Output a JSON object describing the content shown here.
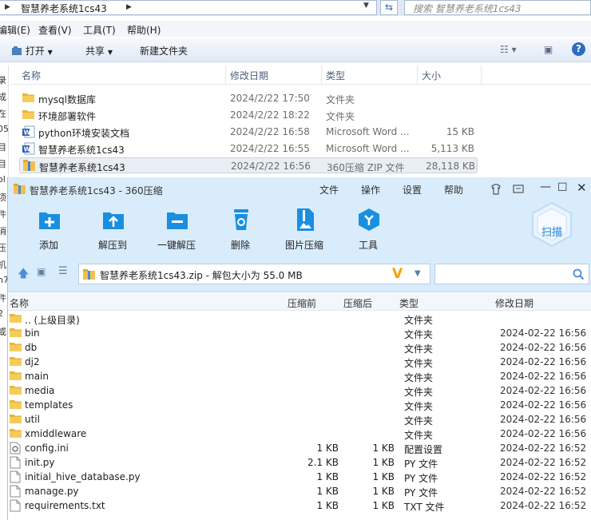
{
  "explorer": {
    "breadcrumb": "智慧养老系统1cs43",
    "search_placeholder": "搜索 智慧养老系统1cs43",
    "menu": [
      "编辑(E)",
      "查看(V)",
      "工具(T)",
      "帮助(H)"
    ],
    "toolbar": {
      "organize": "打开",
      "share": "共享",
      "new_folder": "新建文件夹"
    },
    "columns": {
      "name": "名称",
      "date": "修改日期",
      "type": "类型",
      "size": "大小"
    },
    "files": [
      {
        "name": "mysql数据库",
        "date": "2024/2/22 17:50",
        "type": "文件夹",
        "size": "",
        "icon": "folder-icon"
      },
      {
        "name": "环境部署软件",
        "date": "2024/2/22 18:22",
        "type": "文件夹",
        "size": "",
        "icon": "folder-icon"
      },
      {
        "name": "python环境安装文档",
        "date": "2024/2/22 16:58",
        "type": "Microsoft Word ...",
        "size": "15 KB",
        "icon": "word-doc-icon"
      },
      {
        "name": "智慧养老系统1cs43",
        "date": "2024/2/22 16:55",
        "type": "Microsoft Word ...",
        "size": "5,113 KB",
        "icon": "word-doc-icon"
      },
      {
        "name": "智慧养老系统1cs43",
        "date": "2024/2/22 16:56",
        "type": "360压缩 ZIP 文件",
        "size": "28,118 KB",
        "icon": "zip-archive-icon",
        "selected": true
      }
    ],
    "left_pane_chars": [
      "录",
      "成",
      "在",
      "05",
      "目",
      "目",
      "ol",
      "项",
      "件",
      "消",
      "压",
      "机",
      "n7",
      "件",
      "2",
      "或"
    ]
  },
  "zip": {
    "title": "智慧养老系统1cs43 - 360压缩",
    "menu": [
      "文件",
      "操作",
      "设置",
      "帮助"
    ],
    "tools": [
      {
        "label": "添加",
        "icon": "add-icon"
      },
      {
        "label": "解压到",
        "icon": "extract-to-icon"
      },
      {
        "label": "一键解压",
        "icon": "one-click-extract-icon"
      },
      {
        "label": "删除",
        "icon": "trash-icon"
      },
      {
        "label": "图片压缩",
        "icon": "image-compress-icon"
      },
      {
        "label": "工具",
        "icon": "tools-icon"
      }
    ],
    "scan_label": "扫描",
    "path": "智慧养老系统1cs43.zip - 解包大小为 55.0 MB",
    "columns": {
      "name": "名称",
      "compressed": "压缩前",
      "uncompressed": "压缩后",
      "type": "类型",
      "date": "修改日期"
    },
    "entries": [
      {
        "name": ".. (上级目录)",
        "cs": "",
        "us": "",
        "type": "文件夹",
        "date": "",
        "icon": "folder-icon"
      },
      {
        "name": "bin",
        "cs": "",
        "us": "",
        "type": "文件夹",
        "date": "2024-02-22 16:56",
        "icon": "folder-icon"
      },
      {
        "name": "db",
        "cs": "",
        "us": "",
        "type": "文件夹",
        "date": "2024-02-22 16:56",
        "icon": "folder-icon"
      },
      {
        "name": "dj2",
        "cs": "",
        "us": "",
        "type": "文件夹",
        "date": "2024-02-22 16:56",
        "icon": "folder-icon"
      },
      {
        "name": "main",
        "cs": "",
        "us": "",
        "type": "文件夹",
        "date": "2024-02-22 16:56",
        "icon": "folder-icon"
      },
      {
        "name": "media",
        "cs": "",
        "us": "",
        "type": "文件夹",
        "date": "2024-02-22 16:56",
        "icon": "folder-icon"
      },
      {
        "name": "templates",
        "cs": "",
        "us": "",
        "type": "文件夹",
        "date": "2024-02-22 16:56",
        "icon": "folder-icon"
      },
      {
        "name": "util",
        "cs": "",
        "us": "",
        "type": "文件夹",
        "date": "2024-02-22 16:56",
        "icon": "folder-icon"
      },
      {
        "name": "xmiddleware",
        "cs": "",
        "us": "",
        "type": "文件夹",
        "date": "2024-02-22 16:56",
        "icon": "folder-icon"
      },
      {
        "name": "config.ini",
        "cs": "1 KB",
        "us": "1 KB",
        "type": "配置设置",
        "date": "2024-02-22 16:52",
        "icon": "config-file-icon"
      },
      {
        "name": "init.py",
        "cs": "2.1 KB",
        "us": "1 KB",
        "type": "PY 文件",
        "date": "2024-02-22 16:52",
        "icon": "file-icon"
      },
      {
        "name": "initial_hive_database.py",
        "cs": "1 KB",
        "us": "1 KB",
        "type": "PY 文件",
        "date": "2024-02-22 16:52",
        "icon": "file-icon"
      },
      {
        "name": "manage.py",
        "cs": "1 KB",
        "us": "1 KB",
        "type": "PY 文件",
        "date": "2024-02-22 16:52",
        "icon": "file-icon"
      },
      {
        "name": "requirements.txt",
        "cs": "1 KB",
        "us": "1 KB",
        "type": "TXT 文件",
        "date": "2024-02-22 16:52",
        "icon": "file-icon"
      }
    ]
  },
  "colors": {
    "accent": "#1a8fe0",
    "title_bg": "#d9ecfb",
    "folder": "#f2c04d"
  }
}
